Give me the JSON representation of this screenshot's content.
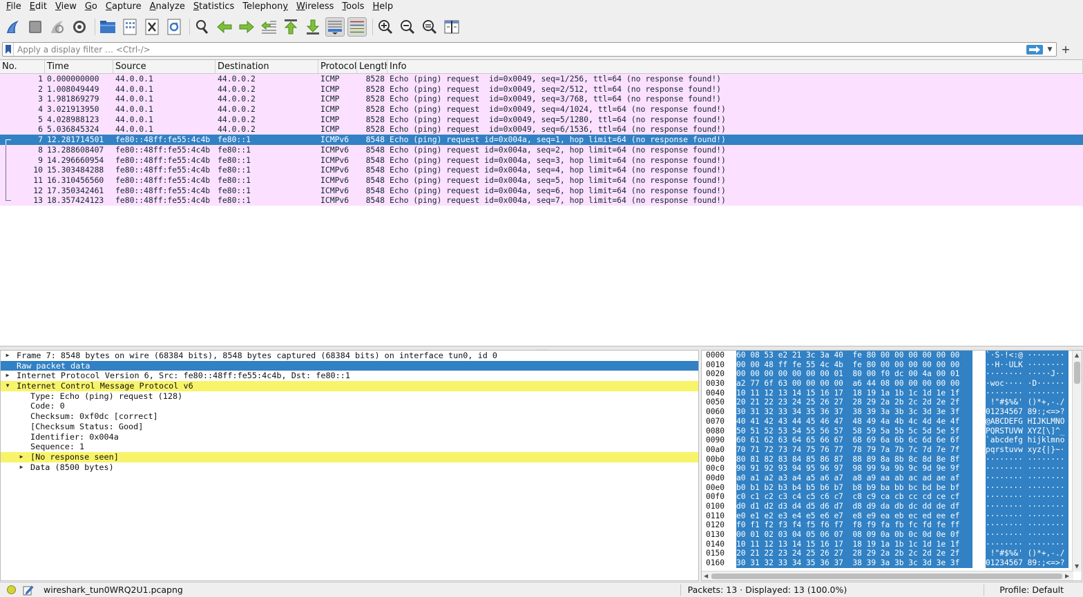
{
  "menu": [
    {
      "label": "File",
      "mn": "F",
      "rest": "ile"
    },
    {
      "label": "Edit",
      "mn": "E",
      "rest": "dit"
    },
    {
      "label": "View",
      "mn": "V",
      "rest": "iew"
    },
    {
      "label": "Go",
      "mn": "G",
      "rest": "o"
    },
    {
      "label": "Capture",
      "mn": "C",
      "rest": "apture"
    },
    {
      "label": "Analyze",
      "mn": "A",
      "rest": "nalyze"
    },
    {
      "label": "Statistics",
      "mn": "S",
      "rest": "tatistics"
    },
    {
      "label": "Telephony",
      "mn": "y",
      "pre": "Telephon",
      "rest": ""
    },
    {
      "label": "Wireless",
      "mn": "W",
      "rest": "ireless"
    },
    {
      "label": "Tools",
      "mn": "T",
      "rest": "ools"
    },
    {
      "label": "Help",
      "mn": "H",
      "rest": "elp"
    }
  ],
  "toolbar": {
    "icons": [
      "shark-fin-start-icon",
      "stop-capture-icon",
      "restart-capture-icon",
      "capture-options-icon",
      "open-file-icon",
      "save-file-icon",
      "close-file-icon",
      "reload-file-icon",
      "find-packet-icon",
      "go-back-icon",
      "go-forward-icon",
      "go-to-packet-icon",
      "first-packet-icon",
      "last-packet-icon",
      "autoscroll-icon",
      "colorize-icon",
      "zoom-in-icon",
      "zoom-out-icon",
      "zoom-normal-icon",
      "resize-columns-icon"
    ]
  },
  "filter": {
    "placeholder": "Apply a display filter … <Ctrl-/>",
    "plus": "+"
  },
  "columns": [
    "No.",
    "Time",
    "Source",
    "Destination",
    "Protocol",
    "Length",
    "Info"
  ],
  "packets": [
    {
      "no": "1",
      "time": "0.000000000",
      "src": "44.0.0.1",
      "dst": "44.0.0.2",
      "proto": "ICMP",
      "len": "8528",
      "info": "Echo (ping) request  id=0x0049, seq=1/256, ttl=64 (no response found!)"
    },
    {
      "no": "2",
      "time": "1.008049449",
      "src": "44.0.0.1",
      "dst": "44.0.0.2",
      "proto": "ICMP",
      "len": "8528",
      "info": "Echo (ping) request  id=0x0049, seq=2/512, ttl=64 (no response found!)"
    },
    {
      "no": "3",
      "time": "1.981869279",
      "src": "44.0.0.1",
      "dst": "44.0.0.2",
      "proto": "ICMP",
      "len": "8528",
      "info": "Echo (ping) request  id=0x0049, seq=3/768, ttl=64 (no response found!)"
    },
    {
      "no": "4",
      "time": "3.021913950",
      "src": "44.0.0.1",
      "dst": "44.0.0.2",
      "proto": "ICMP",
      "len": "8528",
      "info": "Echo (ping) request  id=0x0049, seq=4/1024, ttl=64 (no response found!)"
    },
    {
      "no": "5",
      "time": "4.028988123",
      "src": "44.0.0.1",
      "dst": "44.0.0.2",
      "proto": "ICMP",
      "len": "8528",
      "info": "Echo (ping) request  id=0x0049, seq=5/1280, ttl=64 (no response found!)"
    },
    {
      "no": "6",
      "time": "5.036845324",
      "src": "44.0.0.1",
      "dst": "44.0.0.2",
      "proto": "ICMP",
      "len": "8528",
      "info": "Echo (ping) request  id=0x0049, seq=6/1536, ttl=64 (no response found!)"
    },
    {
      "no": "7",
      "time": "12.281714501",
      "src": "fe80::48ff:fe55:4c4b",
      "dst": "fe80::1",
      "proto": "ICMPv6",
      "len": "8548",
      "info": "Echo (ping) request id=0x004a, seq=1, hop limit=64 (no response found!)",
      "selected": true,
      "bracket": "first"
    },
    {
      "no": "8",
      "time": "13.288608407",
      "src": "fe80::48ff:fe55:4c4b",
      "dst": "fe80::1",
      "proto": "ICMPv6",
      "len": "8548",
      "info": "Echo (ping) request id=0x004a, seq=2, hop limit=64 (no response found!)",
      "bracket": "mid"
    },
    {
      "no": "9",
      "time": "14.296660954",
      "src": "fe80::48ff:fe55:4c4b",
      "dst": "fe80::1",
      "proto": "ICMPv6",
      "len": "8548",
      "info": "Echo (ping) request id=0x004a, seq=3, hop limit=64 (no response found!)",
      "bracket": "mid"
    },
    {
      "no": "10",
      "time": "15.303484288",
      "src": "fe80::48ff:fe55:4c4b",
      "dst": "fe80::1",
      "proto": "ICMPv6",
      "len": "8548",
      "info": "Echo (ping) request id=0x004a, seq=4, hop limit=64 (no response found!)",
      "bracket": "mid"
    },
    {
      "no": "11",
      "time": "16.310456560",
      "src": "fe80::48ff:fe55:4c4b",
      "dst": "fe80::1",
      "proto": "ICMPv6",
      "len": "8548",
      "info": "Echo (ping) request id=0x004a, seq=5, hop limit=64 (no response found!)",
      "bracket": "mid"
    },
    {
      "no": "12",
      "time": "17.350342461",
      "src": "fe80::48ff:fe55:4c4b",
      "dst": "fe80::1",
      "proto": "ICMPv6",
      "len": "8548",
      "info": "Echo (ping) request id=0x004a, seq=6, hop limit=64 (no response found!)",
      "bracket": "mid"
    },
    {
      "no": "13",
      "time": "18.357424123",
      "src": "fe80::48ff:fe55:4c4b",
      "dst": "fe80::1",
      "proto": "ICMPv6",
      "len": "8548",
      "info": "Echo (ping) request id=0x004a, seq=7, hop limit=64 (no response found!)",
      "bracket": "last"
    }
  ],
  "details": [
    {
      "text": "Frame 7: 8548 bytes on wire (68384 bits), 8548 bytes captured (68384 bits) on interface tun0, id 0",
      "level": 0,
      "arrow": "collapsed"
    },
    {
      "text": "Raw packet data",
      "level": 0,
      "arrow": "none",
      "style": "sel"
    },
    {
      "text": "Internet Protocol Version 6, Src: fe80::48ff:fe55:4c4b, Dst: fe80::1",
      "level": 0,
      "arrow": "collapsed"
    },
    {
      "text": "Internet Control Message Protocol v6",
      "level": 0,
      "arrow": "expanded",
      "style": "warn"
    },
    {
      "text": "Type: Echo (ping) request (128)",
      "level": 1,
      "arrow": "none"
    },
    {
      "text": "Code: 0",
      "level": 1,
      "arrow": "none"
    },
    {
      "text": "Checksum: 0xf0dc [correct]",
      "level": 1,
      "arrow": "none"
    },
    {
      "text": "[Checksum Status: Good]",
      "level": 1,
      "arrow": "none"
    },
    {
      "text": "Identifier: 0x004a",
      "level": 1,
      "arrow": "none"
    },
    {
      "text": "Sequence: 1",
      "level": 1,
      "arrow": "none"
    },
    {
      "text": "[No response seen]",
      "level": 1,
      "arrow": "collapsed",
      "style": "warn"
    },
    {
      "text": "Data (8500 bytes)",
      "level": 1,
      "arrow": "collapsed"
    }
  ],
  "bytes": [
    {
      "off": "0000",
      "hex": "60 08 53 e2 21 3c 3a 40  fe 80 00 00 00 00 00 00",
      "asc": "`·S·!<:@ ········"
    },
    {
      "off": "0010",
      "hex": "00 00 48 ff fe 55 4c 4b  fe 80 00 00 00 00 00 00",
      "asc": "··H··ULK ········"
    },
    {
      "off": "0020",
      "hex": "00 00 00 00 00 00 00 01  80 00 f0 dc 00 4a 00 01",
      "asc": "········ ·····J··"
    },
    {
      "off": "0030",
      "hex": "a2 77 6f 63 00 00 00 00  a6 44 08 00 00 00 00 00",
      "asc": "·woc···· ·D······"
    },
    {
      "off": "0040",
      "hex": "10 11 12 13 14 15 16 17  18 19 1a 1b 1c 1d 1e 1f",
      "asc": "········ ········"
    },
    {
      "off": "0050",
      "hex": "20 21 22 23 24 25 26 27  28 29 2a 2b 2c 2d 2e 2f",
      "asc": " !\"#$%&' ()*+,-./"
    },
    {
      "off": "0060",
      "hex": "30 31 32 33 34 35 36 37  38 39 3a 3b 3c 3d 3e 3f",
      "asc": "01234567 89:;<=>?"
    },
    {
      "off": "0070",
      "hex": "40 41 42 43 44 45 46 47  48 49 4a 4b 4c 4d 4e 4f",
      "asc": "@ABCDEFG HIJKLMNO"
    },
    {
      "off": "0080",
      "hex": "50 51 52 53 54 55 56 57  58 59 5a 5b 5c 5d 5e 5f",
      "asc": "PQRSTUVW XYZ[\\]^_"
    },
    {
      "off": "0090",
      "hex": "60 61 62 63 64 65 66 67  68 69 6a 6b 6c 6d 6e 6f",
      "asc": "`abcdefg hijklmno"
    },
    {
      "off": "00a0",
      "hex": "70 71 72 73 74 75 76 77  78 79 7a 7b 7c 7d 7e 7f",
      "asc": "pqrstuvw xyz{|}~·"
    },
    {
      "off": "00b0",
      "hex": "80 81 82 83 84 85 86 87  88 89 8a 8b 8c 8d 8e 8f",
      "asc": "········ ········"
    },
    {
      "off": "00c0",
      "hex": "90 91 92 93 94 95 96 97  98 99 9a 9b 9c 9d 9e 9f",
      "asc": "········ ········"
    },
    {
      "off": "00d0",
      "hex": "a0 a1 a2 a3 a4 a5 a6 a7  a8 a9 aa ab ac ad ae af",
      "asc": "········ ········"
    },
    {
      "off": "00e0",
      "hex": "b0 b1 b2 b3 b4 b5 b6 b7  b8 b9 ba bb bc bd be bf",
      "asc": "········ ········"
    },
    {
      "off": "00f0",
      "hex": "c0 c1 c2 c3 c4 c5 c6 c7  c8 c9 ca cb cc cd ce cf",
      "asc": "········ ········"
    },
    {
      "off": "0100",
      "hex": "d0 d1 d2 d3 d4 d5 d6 d7  d8 d9 da db dc dd de df",
      "asc": "········ ········"
    },
    {
      "off": "0110",
      "hex": "e0 e1 e2 e3 e4 e5 e6 e7  e8 e9 ea eb ec ed ee ef",
      "asc": "········ ········"
    },
    {
      "off": "0120",
      "hex": "f0 f1 f2 f3 f4 f5 f6 f7  f8 f9 fa fb fc fd fe ff",
      "asc": "········ ········"
    },
    {
      "off": "0130",
      "hex": "00 01 02 03 04 05 06 07  08 09 0a 0b 0c 0d 0e 0f",
      "asc": "········ ········"
    },
    {
      "off": "0140",
      "hex": "10 11 12 13 14 15 16 17  18 19 1a 1b 1c 1d 1e 1f",
      "asc": "········ ········"
    },
    {
      "off": "0150",
      "hex": "20 21 22 23 24 25 26 27  28 29 2a 2b 2c 2d 2e 2f",
      "asc": " !\"#$%&' ()*+,-./"
    },
    {
      "off": "0160",
      "hex": "30 31 32 33 34 35 36 37  38 39 3a 3b 3c 3d 3e 3f",
      "asc": "01234567 89:;<=>?"
    }
  ],
  "status": {
    "file": "wireshark_tun0WRQ2U1.pcapng",
    "counts": "Packets: 13 · Displayed: 13 (100.0%)",
    "profile": "Profile: Default"
  },
  "colors": {
    "packet_bg": "#fce0ff",
    "selection": "#3181c4",
    "warning": "#f8f46a"
  }
}
